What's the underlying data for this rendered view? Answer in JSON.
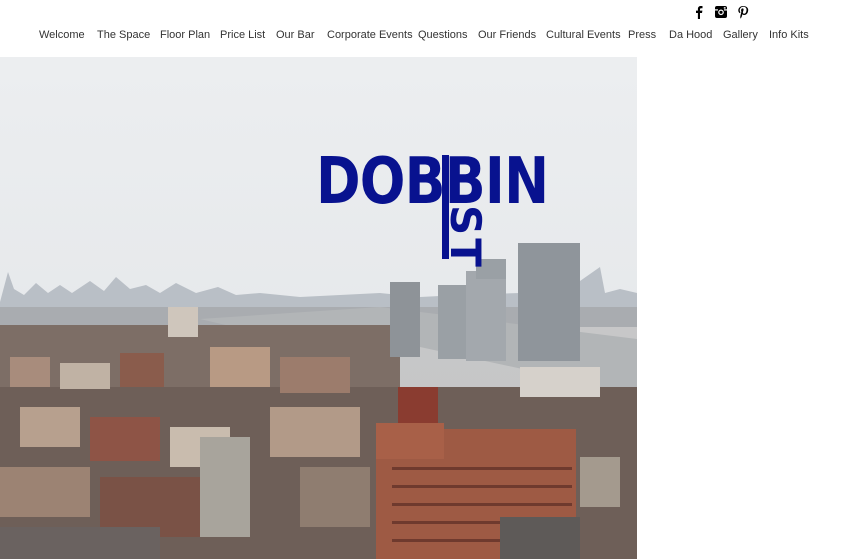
{
  "social": {
    "icons": [
      "facebook-icon",
      "instagram-icon",
      "pinterest-icon"
    ],
    "color": "#000000"
  },
  "nav": {
    "items": [
      "Welcome",
      "The Space",
      "Floor Plan",
      "Price List",
      "Our Bar",
      "Corporate Events",
      "Questions",
      "Our Friends",
      "Cultural Events",
      "Press",
      "Da Hood",
      "Gallery",
      "Info Kits"
    ]
  },
  "logo": {
    "word": "DOBBIN",
    "suffix": "ST",
    "color": "#08128f"
  },
  "colors": {
    "sky": "#e7e9ec",
    "river": "#c9ced3",
    "brick": "#8a4a3a"
  }
}
